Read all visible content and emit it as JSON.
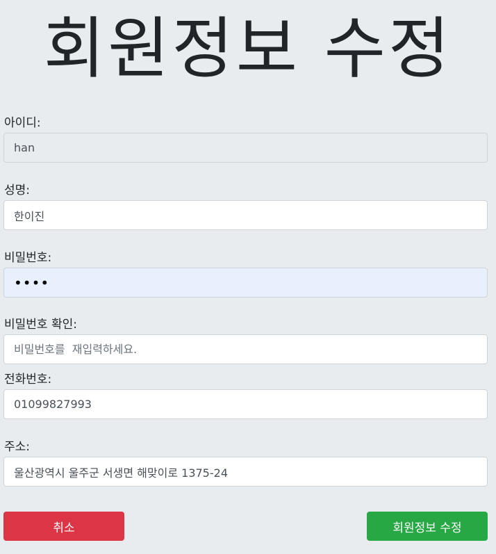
{
  "title": "회원정보 수정",
  "fields": {
    "userid": {
      "label": "아이디:",
      "value": "han",
      "placeholder": ""
    },
    "name": {
      "label": "성명:",
      "value": "한이진",
      "placeholder": ""
    },
    "password": {
      "label": "비밀번호:",
      "value": "1234",
      "placeholder": ""
    },
    "password_confirm": {
      "label": "비밀번호 확인:",
      "value": "",
      "placeholder": "비밀번호를  재입력하세요."
    },
    "phone": {
      "label": "전화번호:",
      "value": "01099827993",
      "placeholder": ""
    },
    "address": {
      "label": "주소:",
      "value": "울산광역시 울주군 서생면 해맞이로 1375-24",
      "placeholder": ""
    }
  },
  "buttons": {
    "cancel_label": "취소",
    "submit_label": "회원정보 수정"
  },
  "colors": {
    "background": "#e9ecef",
    "cancel": "#dc3545",
    "submit": "#28a745"
  }
}
